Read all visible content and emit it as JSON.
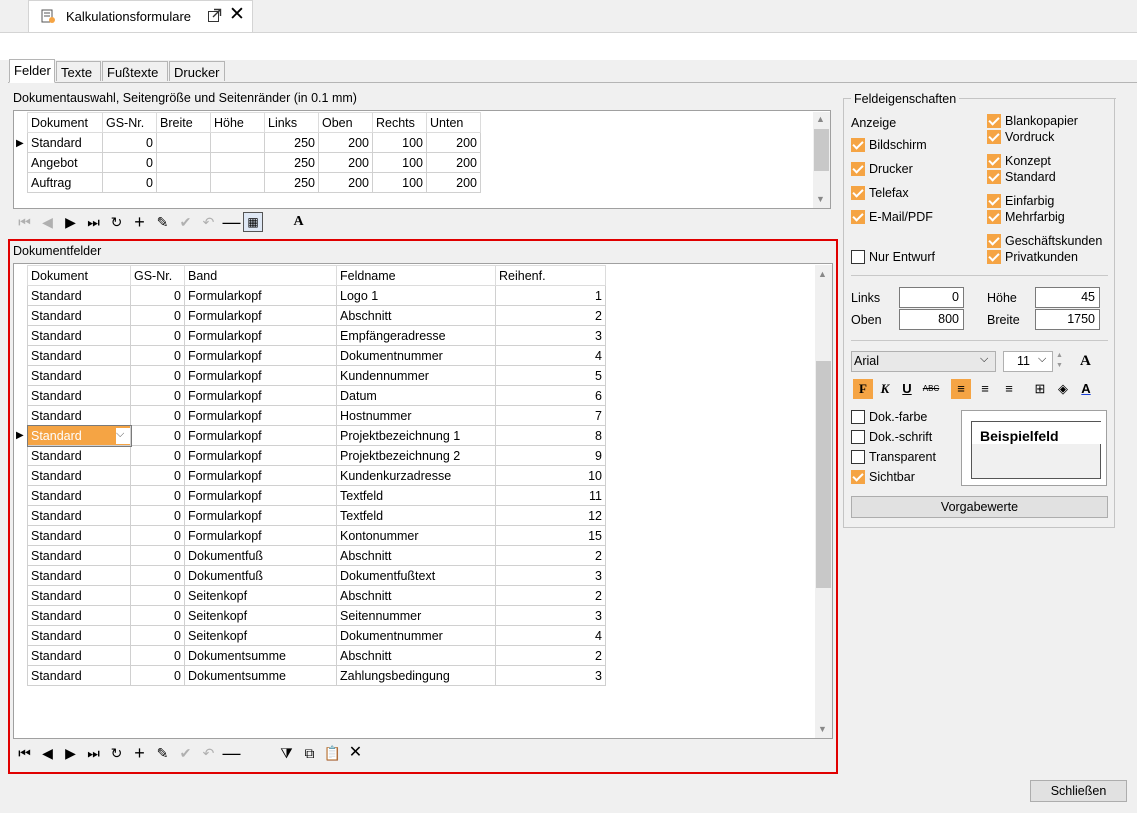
{
  "window": {
    "title": "Kalkulationsformulare"
  },
  "tabs": [
    "Felder",
    "Texte",
    "Fußtexte",
    "Drucker"
  ],
  "docsection": {
    "title": "Dokumentauswahl, Seitengröße und Seitenränder (in 0.1 mm)",
    "columns": [
      "Dokument",
      "GS-Nr.",
      "Breite",
      "Höhe",
      "Links",
      "Oben",
      "Rechts",
      "Unten"
    ],
    "rows": [
      [
        "Standard",
        "0",
        "",
        "",
        "250",
        "200",
        "100",
        "200"
      ],
      [
        "Angebot",
        "0",
        "",
        "",
        "250",
        "200",
        "100",
        "200"
      ],
      [
        "Auftrag",
        "0",
        "",
        "",
        "250",
        "200",
        "100",
        "200"
      ]
    ]
  },
  "fieldsection": {
    "title": "Dokumentfelder",
    "columns": [
      "Dokument",
      "GS-Nr.",
      "Band",
      "Feldname",
      "Reihenf."
    ],
    "rows": [
      [
        "Standard",
        "0",
        "Formularkopf",
        "Logo 1",
        "1"
      ],
      [
        "Standard",
        "0",
        "Formularkopf",
        "Abschnitt",
        "2"
      ],
      [
        "Standard",
        "0",
        "Formularkopf",
        "Empfängeradresse",
        "3"
      ],
      [
        "Standard",
        "0",
        "Formularkopf",
        "Dokumentnummer",
        "4"
      ],
      [
        "Standard",
        "0",
        "Formularkopf",
        "Kundennummer",
        "5"
      ],
      [
        "Standard",
        "0",
        "Formularkopf",
        "Datum",
        "6"
      ],
      [
        "Standard",
        "0",
        "Formularkopf",
        "Hostnummer",
        "7"
      ],
      [
        "Standard",
        "0",
        "Formularkopf",
        "Projektbezeichnung 1",
        "8"
      ],
      [
        "Standard",
        "0",
        "Formularkopf",
        "Projektbezeichnung 2",
        "9"
      ],
      [
        "Standard",
        "0",
        "Formularkopf",
        "Kundenkurzadresse",
        "10"
      ],
      [
        "Standard",
        "0",
        "Formularkopf",
        "Textfeld",
        "11"
      ],
      [
        "Standard",
        "0",
        "Formularkopf",
        "Textfeld",
        "12"
      ],
      [
        "Standard",
        "0",
        "Formularkopf",
        "Kontonummer",
        "15"
      ],
      [
        "Standard",
        "0",
        "Dokumentfuß",
        "Abschnitt",
        "2"
      ],
      [
        "Standard",
        "0",
        "Dokumentfuß",
        "Dokumentfußtext",
        "3"
      ],
      [
        "Standard",
        "0",
        "Seitenkopf",
        "Abschnitt",
        "2"
      ],
      [
        "Standard",
        "0",
        "Seitenkopf",
        "Seitennummer",
        "3"
      ],
      [
        "Standard",
        "0",
        "Seitenkopf",
        "Dokumentnummer",
        "4"
      ],
      [
        "Standard",
        "0",
        "Dokumentsumme",
        "Abschnitt",
        "2"
      ],
      [
        "Standard",
        "0",
        "Dokumentsumme",
        "Zahlungsbedingung",
        "3"
      ]
    ],
    "selected_row": 7
  },
  "props": {
    "title": "Feldeigenschaften",
    "anzeige_label": "Anzeige",
    "left_checks": [
      {
        "label": "Bildschirm",
        "checked": true
      },
      {
        "label": "Drucker",
        "checked": true
      },
      {
        "label": "Telefax",
        "checked": true
      },
      {
        "label": "E-Mail/PDF",
        "checked": true
      }
    ],
    "right_checks": [
      {
        "label": "Blankopapier",
        "checked": true
      },
      {
        "label": "Vordruck",
        "checked": true
      },
      {
        "label": "Konzept",
        "checked": true
      },
      {
        "label": "Standard",
        "checked": true
      },
      {
        "label": "Einfarbig",
        "checked": true
      },
      {
        "label": "Mehrfarbig",
        "checked": true
      },
      {
        "label": "Geschäftskunden",
        "checked": true
      },
      {
        "label": "Privatkunden",
        "checked": true
      }
    ],
    "nur_entwurf": {
      "label": "Nur Entwurf",
      "checked": false
    },
    "links_label": "Links",
    "links_value": "0",
    "hoehe_label": "Höhe",
    "hoehe_value": "45",
    "oben_label": "Oben",
    "oben_value": "800",
    "breite_label": "Breite",
    "breite_value": "1750",
    "font": "Arial",
    "size": "11",
    "bottom_checks": [
      {
        "label": "Dok.-farbe",
        "checked": false
      },
      {
        "label": "Dok.-schrift",
        "checked": false
      },
      {
        "label": "Transparent",
        "checked": false
      },
      {
        "label": "Sichtbar",
        "checked": true
      }
    ],
    "preview": "Beispielfeld",
    "defaults_button": "Vorgabewerte"
  },
  "close_button": "Schließen",
  "accent_color": "#f5a444",
  "highlight_color": "#e00000"
}
